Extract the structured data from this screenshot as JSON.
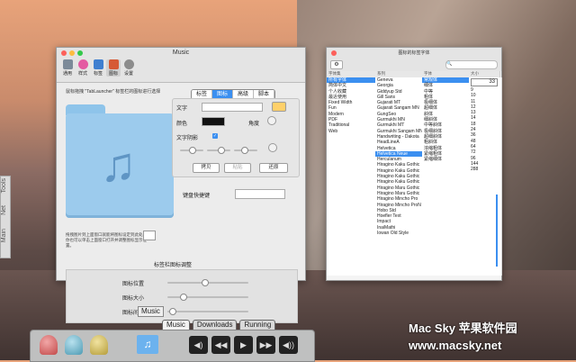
{
  "music_window": {
    "title": "Music",
    "toolbar": [
      {
        "label": "通用",
        "color": "#7c8a99"
      },
      {
        "label": "样式",
        "color": "#e45aa2"
      },
      {
        "label": "标签",
        "color": "#3f7fd0"
      },
      {
        "label": "图标",
        "color": "#d65a35"
      },
      {
        "label": "设置",
        "color": "#8c8c8c"
      }
    ],
    "description": "鼠标拖拽 \"TabLauncher\" 标签栏的图标进行选择",
    "hint": "拖拽图片到上面窗口就能将图标设定到此处。你也可以单击上面窗口打开并调整图标显示位置。",
    "tabs": [
      "标签",
      "图标",
      "高级",
      "脚本"
    ],
    "labels": {
      "text": "文字",
      "color": "颜色",
      "angle": "角度",
      "text_shadow": "文字阴影",
      "shortcut": "键盘快捷键",
      "section": "标签栏图标调整",
      "icon_pos": "图标位置",
      "icon_size": "图标大小",
      "icon_gap": "图标间距"
    },
    "buttons": {
      "copy": "拷贝",
      "paste": "粘贴",
      "restore": "还原"
    }
  },
  "font_window": {
    "title": "图标的标签字体",
    "columns": [
      "字体集",
      "系列",
      "字体",
      "大小"
    ],
    "size_value": "33",
    "collections": [
      "所有字体",
      "简体中文",
      "个人收藏",
      "最近使用",
      "Fixed Width",
      "Fun",
      "Modern",
      "PDF",
      "Traditional",
      "Web"
    ],
    "families": [
      "Geneva",
      "Georgia",
      "Giddyup Std",
      "Gill Sans",
      "Gujarati MT",
      "Gujarati Sangam MN",
      "GungSeo",
      "Gurmukhi MN",
      "Gurmukhi MT",
      "Gurmukhi Sangam MN",
      "Handwriting - Dakota",
      "HeadLineA",
      "Helvetica",
      "Helvetica Neue",
      "Herculanum",
      "Hiragino Kaku Gothic",
      "Hiragino Kaku Gothic",
      "Hiragino Kaku Gothic",
      "Hiragino Kaku Gothic",
      "Hiragino Maru Gothic",
      "Hiragino Maru Gothic",
      "Hiragino Mincho Pro",
      "Hiragino Mincho ProN",
      "Hobo Std",
      "Hoefler Text",
      "Impact",
      "InaiMathi",
      "Iowan Old Style"
    ],
    "typefaces": [
      "常规体",
      "细体",
      "中等",
      "粗体",
      "极细体",
      "超细体",
      "斜体",
      "细斜体",
      "中等斜体",
      "极细斜体",
      "超细斜体",
      "粗斜体",
      "浓缩粗体",
      "紧缩粗体",
      "紧缩细体"
    ],
    "sizes": [
      "9",
      "10",
      "11",
      "12",
      "13",
      "14",
      "18",
      "24",
      "36",
      "48",
      "64",
      "72",
      "96",
      "144",
      "288"
    ]
  },
  "side_tabs": [
    "Tools",
    "Net",
    "Main"
  ],
  "bottom_bar": {
    "tooltip": "Music",
    "tabs": [
      "Music",
      "Downloads",
      "Running"
    ]
  },
  "watermark": {
    "line1": "Mac Sky 苹果软件园",
    "line2": "www.macsky.net"
  }
}
